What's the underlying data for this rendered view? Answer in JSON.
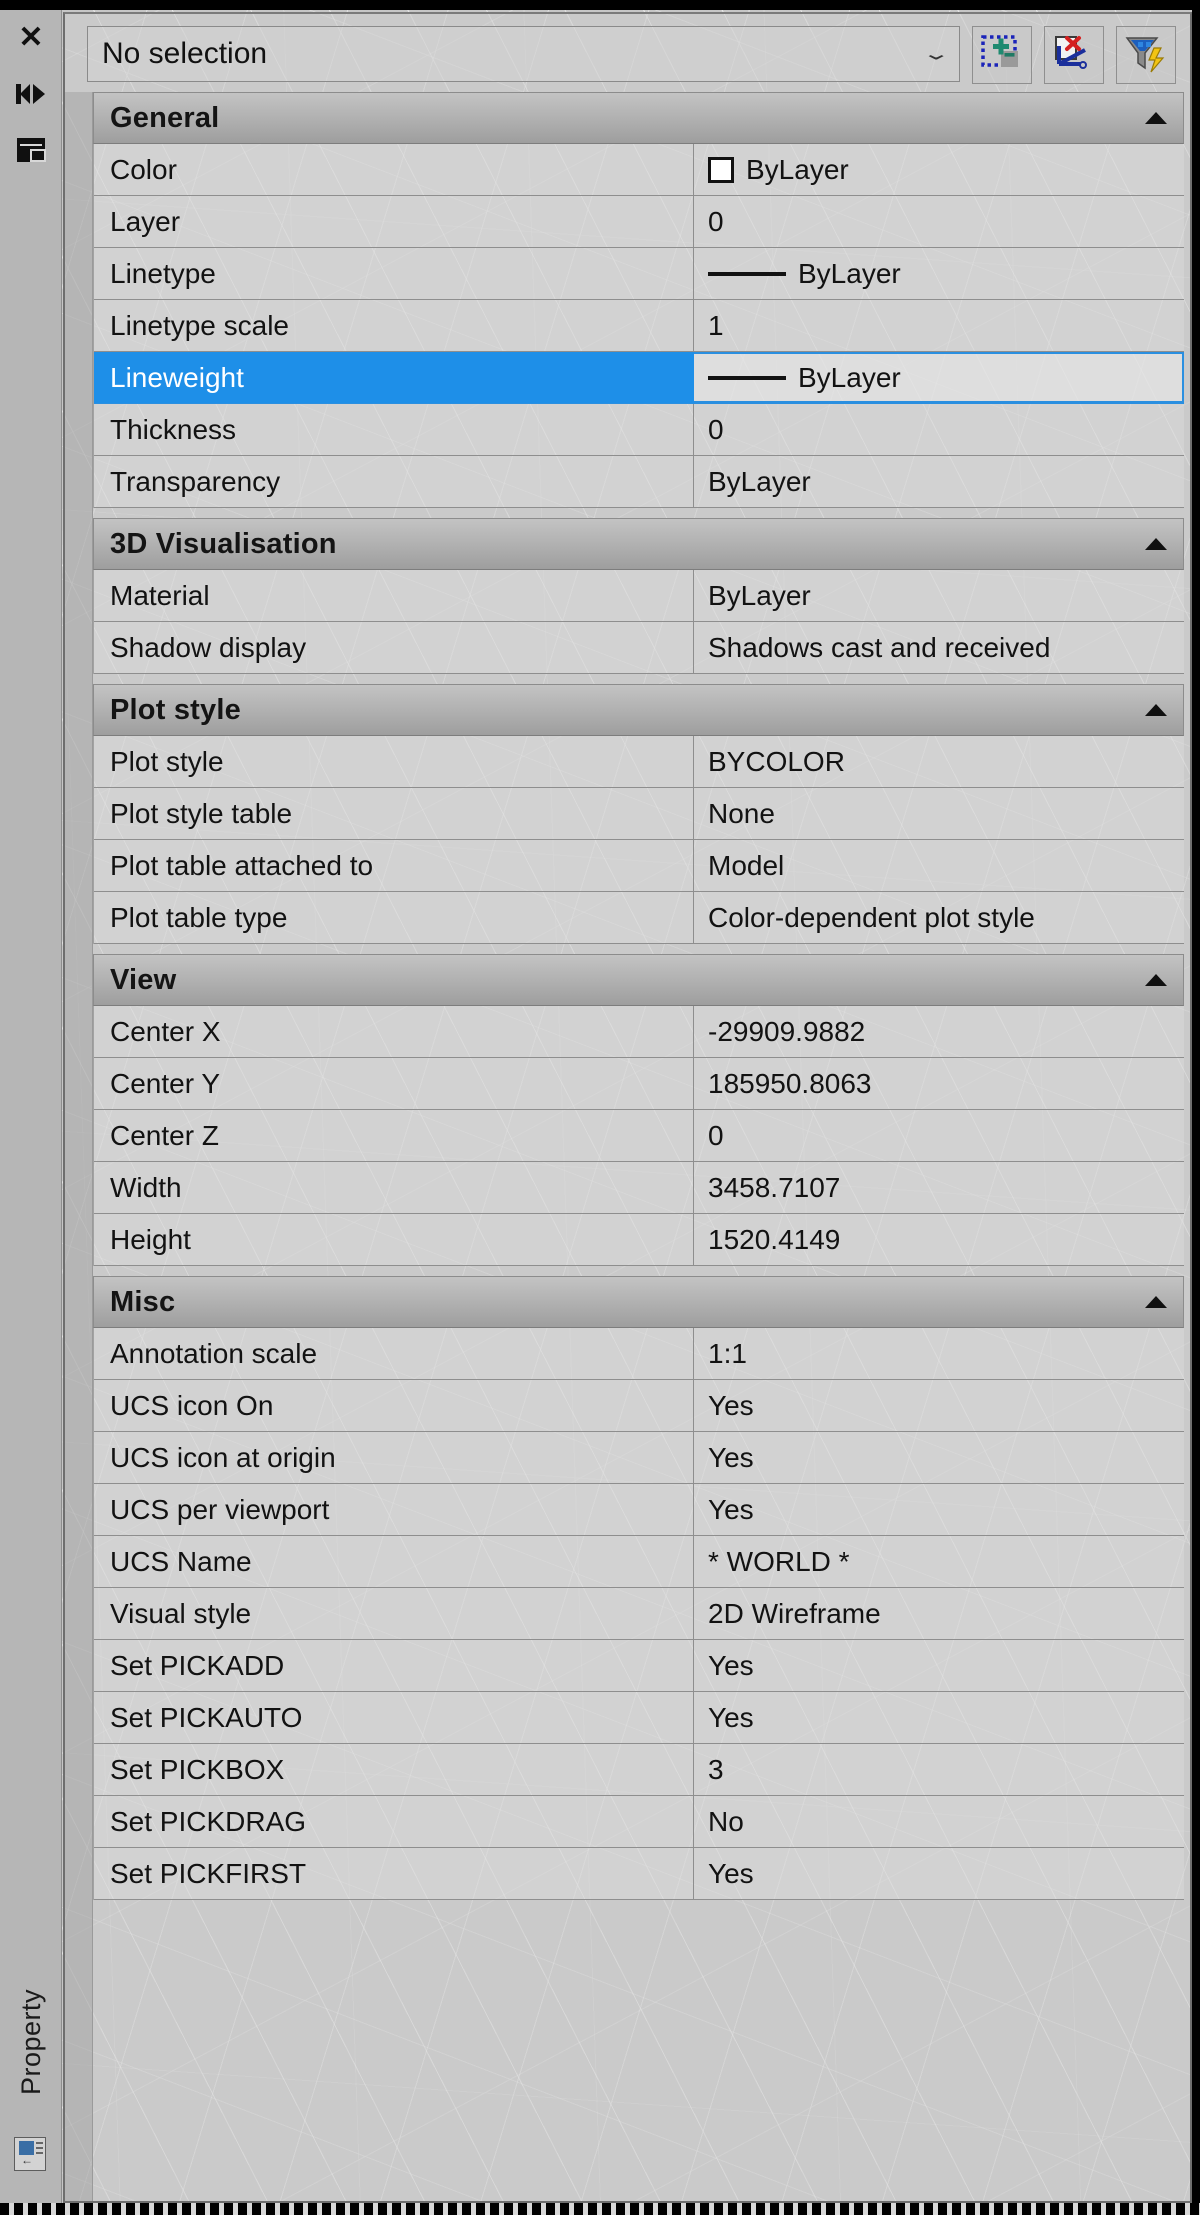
{
  "panel": {
    "tab_label": "Property",
    "icons": {
      "close": "close-icon",
      "autohide": "auto-hide-icon",
      "menu": "panel-menu-icon",
      "bottom": "docking-icon"
    }
  },
  "toolbar": {
    "selection_value": "No selection",
    "chevron": "⌄",
    "buttons": [
      {
        "name": "quick-select-button",
        "title": "Quick Select"
      },
      {
        "name": "select-objects-button",
        "title": "Select Objects"
      },
      {
        "name": "filter-button",
        "title": "Quick Select Filter"
      }
    ]
  },
  "sections": [
    {
      "title": "General",
      "collapsed": false,
      "rows": [
        {
          "label": "Color",
          "value": "ByLayer",
          "swatch": "color",
          "selected": false
        },
        {
          "label": "Layer",
          "value": "0",
          "swatch": null,
          "selected": false
        },
        {
          "label": "Linetype",
          "value": "ByLayer",
          "swatch": "line",
          "selected": false
        },
        {
          "label": "Linetype scale",
          "value": "1",
          "swatch": null,
          "selected": false
        },
        {
          "label": "Lineweight",
          "value": "ByLayer",
          "swatch": "line",
          "selected": true
        },
        {
          "label": "Thickness",
          "value": "0",
          "swatch": null,
          "selected": false
        },
        {
          "label": "Transparency",
          "value": "ByLayer",
          "swatch": null,
          "selected": false
        }
      ]
    },
    {
      "title": "3D Visualisation",
      "collapsed": false,
      "rows": [
        {
          "label": "Material",
          "value": "ByLayer",
          "swatch": null,
          "selected": false
        },
        {
          "label": "Shadow display",
          "value": "Shadows cast and received",
          "swatch": null,
          "selected": false
        }
      ]
    },
    {
      "title": "Plot style",
      "collapsed": false,
      "rows": [
        {
          "label": "Plot style",
          "value": "BYCOLOR",
          "swatch": null,
          "selected": false
        },
        {
          "label": "Plot style table",
          "value": "None",
          "swatch": null,
          "selected": false
        },
        {
          "label": "Plot table attached to",
          "value": "Model",
          "swatch": null,
          "selected": false
        },
        {
          "label": "Plot table type",
          "value": "Color-dependent plot style",
          "swatch": null,
          "selected": false
        }
      ]
    },
    {
      "title": "View",
      "collapsed": false,
      "rows": [
        {
          "label": "Center X",
          "value": "-29909.9882",
          "swatch": null,
          "selected": false
        },
        {
          "label": "Center Y",
          "value": "185950.8063",
          "swatch": null,
          "selected": false
        },
        {
          "label": "Center Z",
          "value": "0",
          "swatch": null,
          "selected": false
        },
        {
          "label": "Width",
          "value": "3458.7107",
          "swatch": null,
          "selected": false
        },
        {
          "label": "Height",
          "value": "1520.4149",
          "swatch": null,
          "selected": false
        }
      ]
    },
    {
      "title": "Misc",
      "collapsed": false,
      "rows": [
        {
          "label": "Annotation scale",
          "value": "1:1",
          "swatch": null,
          "selected": false
        },
        {
          "label": "UCS icon On",
          "value": "Yes",
          "swatch": null,
          "selected": false
        },
        {
          "label": "UCS icon at origin",
          "value": "Yes",
          "swatch": null,
          "selected": false
        },
        {
          "label": "UCS per viewport",
          "value": "Yes",
          "swatch": null,
          "selected": false
        },
        {
          "label": "UCS Name",
          "value": "* WORLD *",
          "swatch": null,
          "selected": false
        },
        {
          "label": "Visual style",
          "value": "2D Wireframe",
          "swatch": null,
          "selected": false
        },
        {
          "label": "Set PICKADD",
          "value": "Yes",
          "swatch": null,
          "selected": false
        },
        {
          "label": "Set PICKAUTO",
          "value": "Yes",
          "swatch": null,
          "selected": false
        },
        {
          "label": "Set PICKBOX",
          "value": "3",
          "swatch": null,
          "selected": false
        },
        {
          "label": "Set PICKDRAG",
          "value": "No",
          "swatch": null,
          "selected": false
        },
        {
          "label": "Set PICKFIRST",
          "value": "Yes",
          "swatch": null,
          "selected": false
        }
      ]
    }
  ],
  "colors": {
    "selection_blue": "#1e8fe8",
    "section_header": "#b3b3b3",
    "row_background": "#e0e0e0",
    "panel_border": "#6e6e6e"
  }
}
